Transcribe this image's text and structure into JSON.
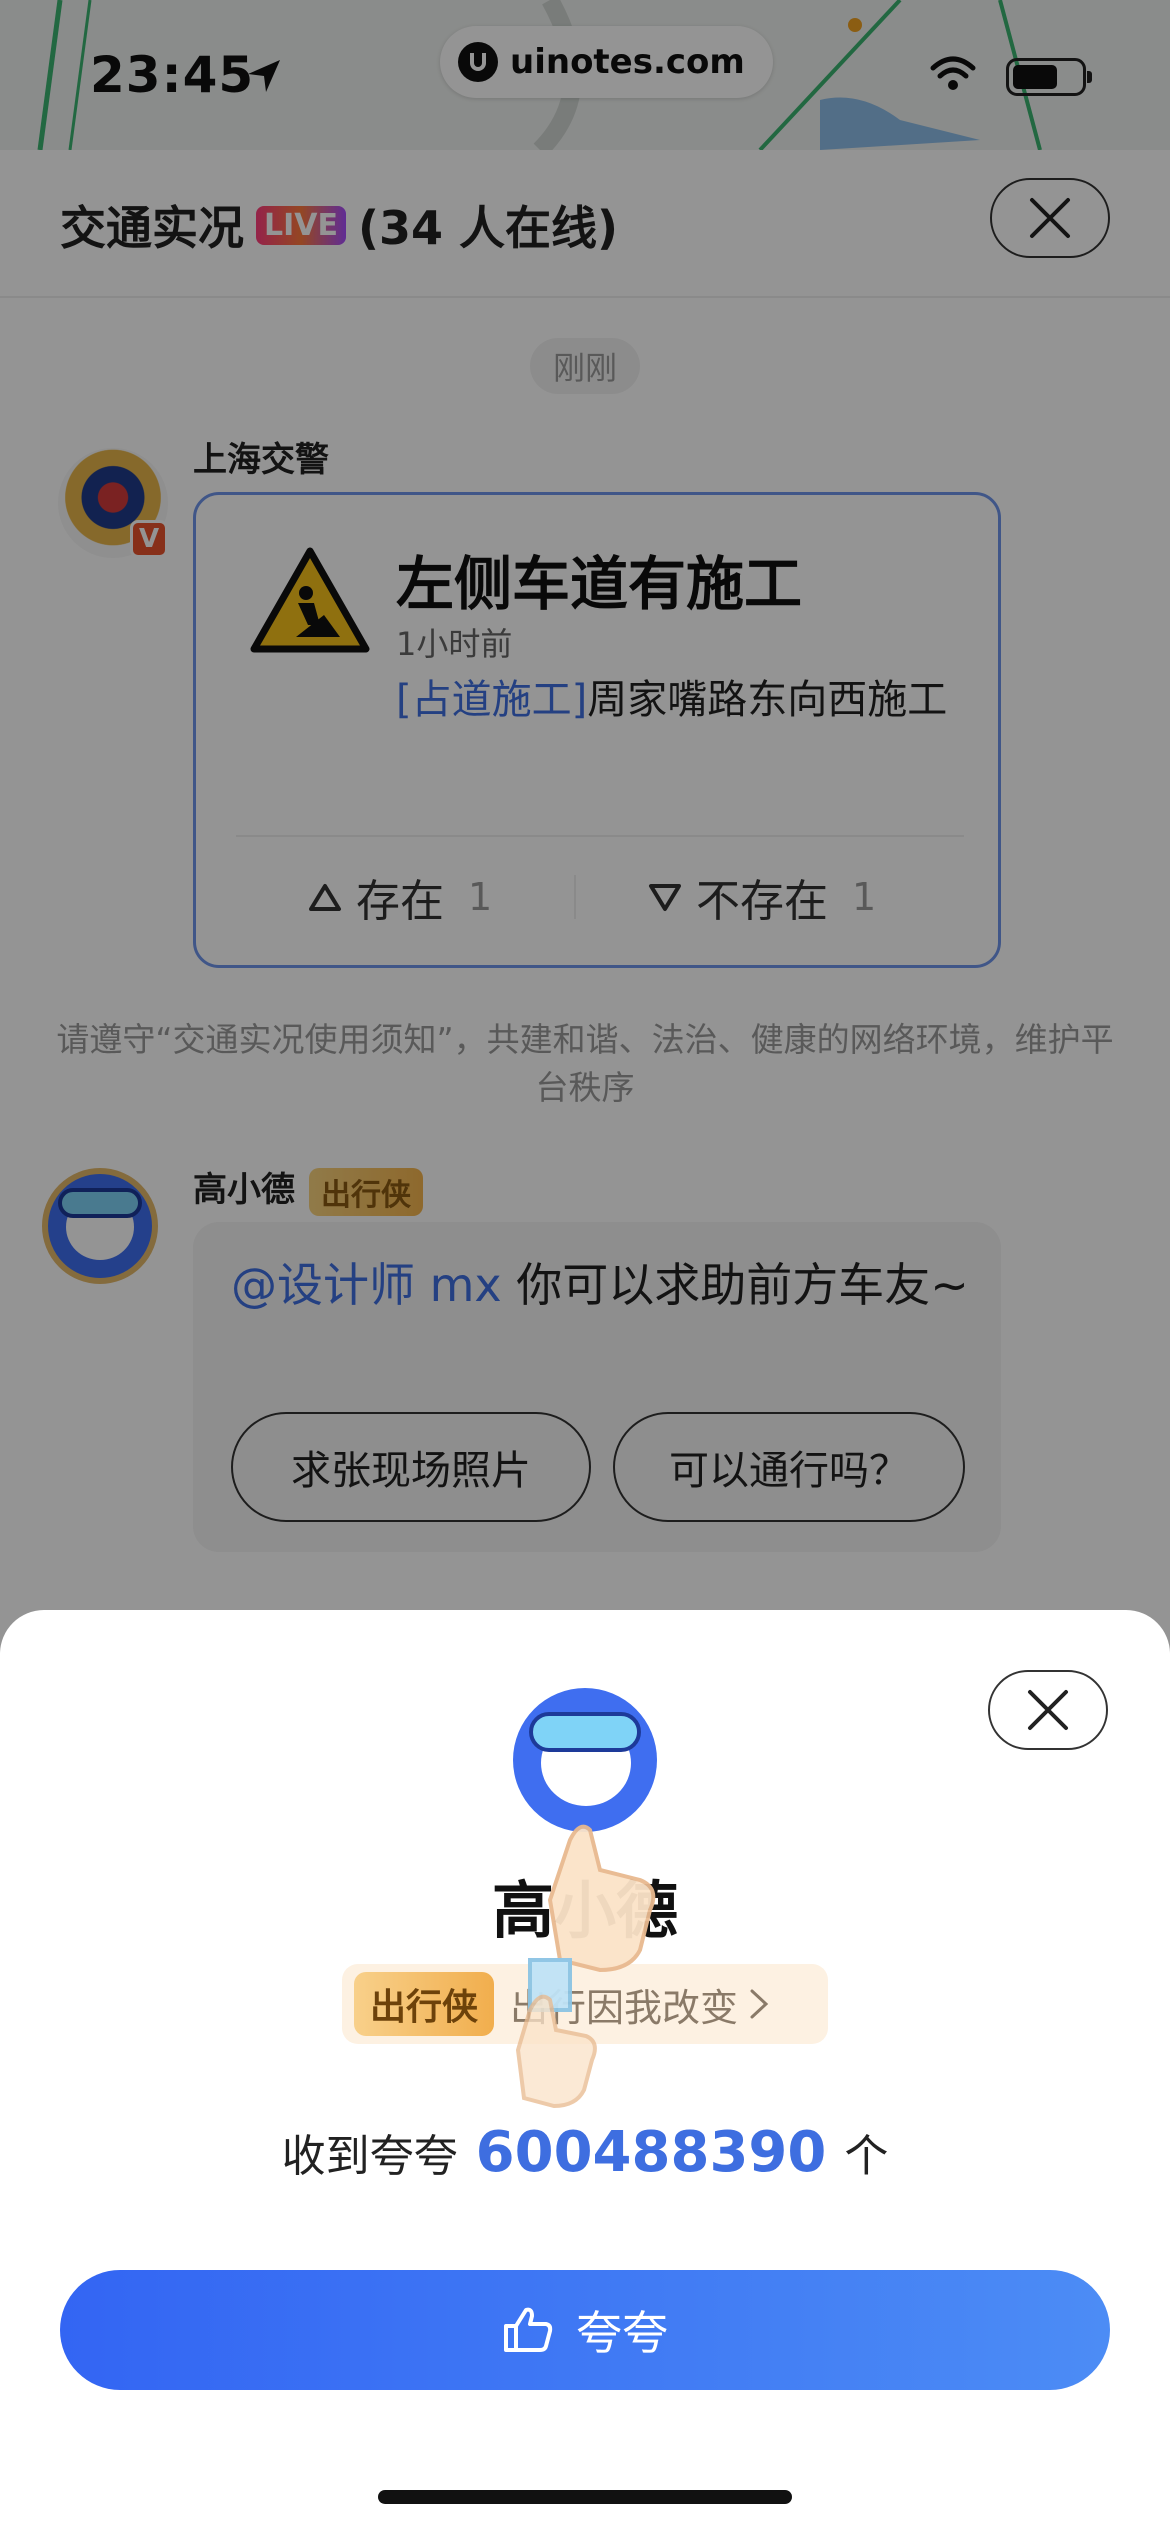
{
  "status_bar": {
    "time": "23:45",
    "watermark": "uinotes.com"
  },
  "header": {
    "title": "交通实况",
    "live_label": "LIVE",
    "online": "(34 人在线)"
  },
  "feed": {
    "time_chip": "刚刚",
    "post1": {
      "sender": "上海交警",
      "verified_badge": "V",
      "card": {
        "title": "左侧车道有施工",
        "time": "1小时前",
        "tag": "[占道施工]",
        "description": "周家嘴路东向西施工",
        "exists_label": "存在",
        "exists_count": "1",
        "not_exists_label": "不存在",
        "not_exists_count": "1"
      }
    },
    "rules": "请遵守“交通实况使用须知”，共建和谐、法治、健康的网络环境，维护平台秩序",
    "post2": {
      "sender": "高小德",
      "badge": "出行侠",
      "mention": "@设计师 mx",
      "message": " 你可以求助前方车友~",
      "reply1": "求张现场照片",
      "reply2": "可以通行吗？"
    }
  },
  "sheet": {
    "name": "高小德",
    "badge": "出行侠",
    "slogan": "出行因我改变",
    "count_prefix": "收到夸夸",
    "count": "600488390",
    "count_suffix": "个",
    "button_label": "夸夸"
  },
  "colors": {
    "accent": "#3e6ee0",
    "button_start": "#3365f3",
    "button_end": "#4c8cf5",
    "badge_gold": "#f1ae4d"
  },
  "icons": [
    "location-arrow-icon",
    "wifi-icon",
    "battery-icon",
    "close-icon",
    "construction-warning-icon",
    "triangle-up-icon",
    "triangle-down-icon",
    "chevron-right-icon",
    "thumbs-up-icon"
  ]
}
